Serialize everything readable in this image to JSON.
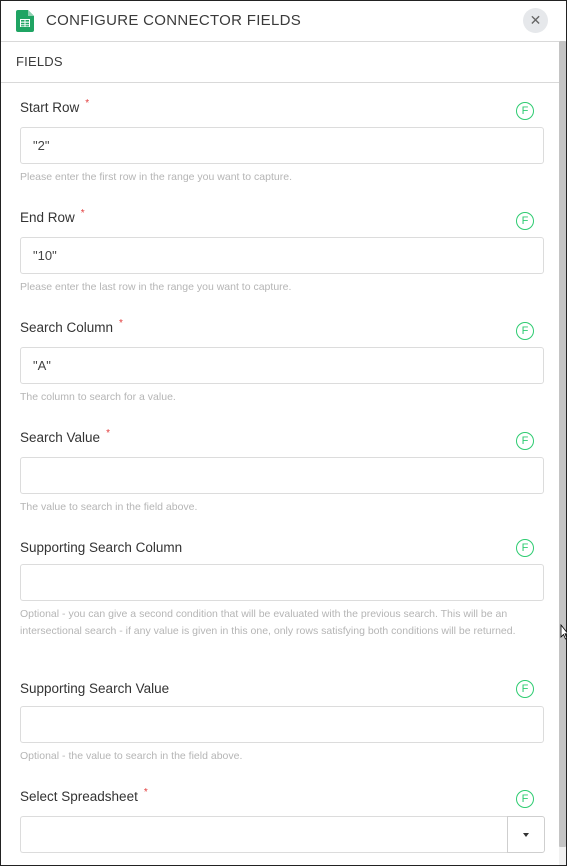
{
  "header": {
    "title": "CONFIGURE CONNECTOR FIELDS",
    "icon": "google-sheets-icon",
    "close_label": "✕"
  },
  "section": {
    "label": "FIELDS"
  },
  "fields": [
    {
      "label": "Start Row",
      "required": true,
      "badge": "F",
      "value": "\"2\"",
      "help": "Please enter the first row in the range you want to capture."
    },
    {
      "label": "End Row",
      "required": true,
      "badge": "F",
      "value": "\"10\"",
      "help": "Please enter the last row in the range you want to capture."
    },
    {
      "label": "Search Column",
      "required": true,
      "badge": "F",
      "value": "\"A\"",
      "help": "The column to search for a value."
    },
    {
      "label": "Search Value",
      "required": true,
      "badge": "F",
      "value": "",
      "help": "The value to search in the field above."
    },
    {
      "label": "Supporting Search Column",
      "required": false,
      "badge": "F",
      "value": "",
      "help": "Optional - you can give a second condition that will be evaluated with the previous search. This will be an intersectional search - if any value is given in this one, only rows satisfying both conditions will be returned."
    },
    {
      "label": "Supporting Search Value",
      "required": false,
      "badge": "F",
      "value": "",
      "help": "Optional - the value to search in the field above."
    },
    {
      "label": "Select Spreadsheet",
      "required": true,
      "badge": "F",
      "value": ""
    }
  ],
  "required_marker": "*",
  "colors": {
    "accent_green": "#2ecc71",
    "required_red": "#e23c3c",
    "sheets_green": "#1fa463"
  }
}
